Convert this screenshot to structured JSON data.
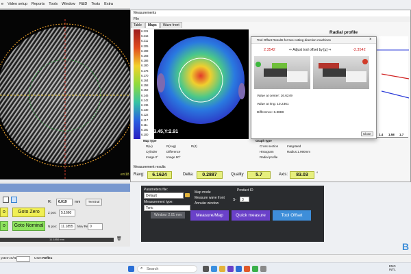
{
  "menu": [
    "e",
    "Video setup",
    "Reports",
    "Tools",
    "Window",
    "R&D",
    "Tests",
    "Extra"
  ],
  "cam_watermark": "ent18",
  "measurements_window": {
    "title": "Measurements",
    "file_menu": "File",
    "tabs": [
      "Table",
      "Maps",
      "Wave front"
    ],
    "active_tab": "Maps",
    "color_scale": [
      "6.221",
      "6.216",
      "6.211",
      "6.205",
      "6.199",
      "6.193",
      "6.186",
      "6.180",
      "6.176",
      "6.170",
      "6.164",
      "6.158",
      "6.152",
      "6.146",
      "6.142",
      "6.136",
      "6.130",
      "6.122",
      "6.117",
      "6.111",
      "6.105",
      "6.100"
    ],
    "map_coords": "X:-3.45,Y:2.91",
    "radial_profile_title": "Radial profile",
    "radial_ticks": [
      "1.4",
      "1.58",
      "1.7"
    ],
    "map_type": {
      "label": "Map type",
      "options": [
        "R(ω)",
        "R(Avg)",
        "R(4)",
        "Cylinder",
        "Difference",
        "Image 0°",
        "Image 90°"
      ],
      "selected": "R(Avg)"
    },
    "graph_type": {
      "label": "Graph type",
      "options": [
        "Cross section",
        "Histogram",
        "Radial profile"
      ],
      "selected": "Radial profile",
      "integrated_label": "Integrated",
      "radius_label": "Radius:1.990mm"
    },
    "results": {
      "label": "Measurement results",
      "ravg_label": "Ravg:",
      "ravg": "6.1624",
      "delta_label": "Delta:",
      "delta": "0.2887",
      "quality_label": "Quality",
      "quality": "5.7",
      "axis_label": "Axis:",
      "axis": "83.03",
      "axis_unit": "°"
    }
  },
  "dialog": {
    "title": "Tool Offset Results for two cutting direction machines",
    "left_value": "2.3542",
    "center_label": "⇐ Adjust tool offset by [µ] ⇒",
    "right_value": "-2.3542",
    "value_center": "Value at center: 16.6249",
    "value_ring": "Value at ring: 10.2361",
    "difference": "Difference: 6.3888",
    "close_label": "Close",
    "close_icon": "×"
  },
  "left_panel": {
    "r_label": "R:",
    "r_value": "6.019",
    "r_unit": "mm",
    "terminal_label": "Terminal",
    "z_label": "Z pos:",
    "z_value": "5.1660",
    "n_label": "N pos:",
    "n_value": "11.1855",
    "mov_label": "Mov Rel:",
    "mov_value": "0",
    "goto_zero": "Goto Zero",
    "goto_nominal": "Goto Nominal",
    "side_btn_top": "o",
    "side_btn_bottom": "o",
    "bottom_value": "11.1850 mm"
  },
  "params_panel": {
    "params_file_label": "Parameters file:",
    "params_file_value": "Default",
    "measurement_type_label": "Measurement type:",
    "measurement_type_value": "Toric",
    "window_label": "Window: 2.01 mm",
    "map_mode": "Map mode",
    "measure_wave_front": "Measure wave front",
    "annular_window": "Annular window",
    "product_id_label": "Product ID",
    "product_id_prefix": "S-",
    "product_id_value": "3",
    "measure_map": "Measure/Map",
    "quick_measure": "Quick measure",
    "tool_offset": "Tool Offset"
  },
  "status_bar": {
    "system_sn_label": "ystem S/N:",
    "user_label": "User:",
    "user_value": "Reflex"
  },
  "taskbar": {
    "search_placeholder": "Search",
    "lang": "ENG\nINTL",
    "logo_letter": "B"
  },
  "colors": {
    "accent_purple": "#6a41c9",
    "accent_blue": "#3e8ed9",
    "result_yellow": "#e6ef7d",
    "goto_zero": "#f0ef54",
    "goto_nominal": "#8fe35e"
  }
}
